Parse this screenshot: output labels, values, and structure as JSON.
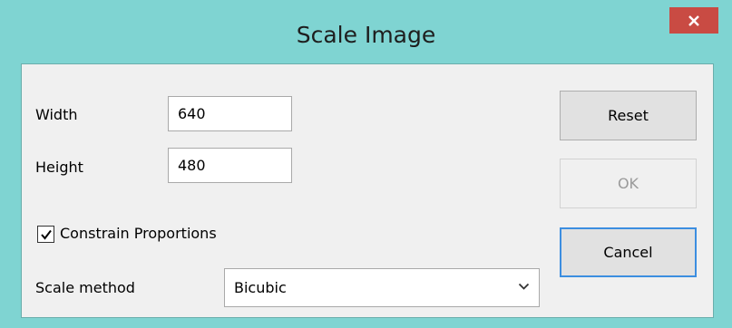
{
  "window": {
    "title": "Scale Image"
  },
  "form": {
    "width_label": "Width",
    "width_value": "640",
    "height_label": "Height",
    "height_value": "480",
    "constrain_label": "Constrain Proportions",
    "constrain_checked": true,
    "scale_method_label": "Scale method",
    "scale_method_value": "Bicubic"
  },
  "buttons": {
    "reset": "Reset",
    "ok": "OK",
    "cancel": "Cancel"
  },
  "colors": {
    "titlebar": "#7fd4d2",
    "close_button": "#c94b43",
    "client_background": "#f0f0f0",
    "focus_border": "#3c8ee0"
  },
  "icons": {
    "close": "close-icon",
    "checkmark": "checkmark-icon",
    "dropdown": "chevron-down-icon"
  }
}
